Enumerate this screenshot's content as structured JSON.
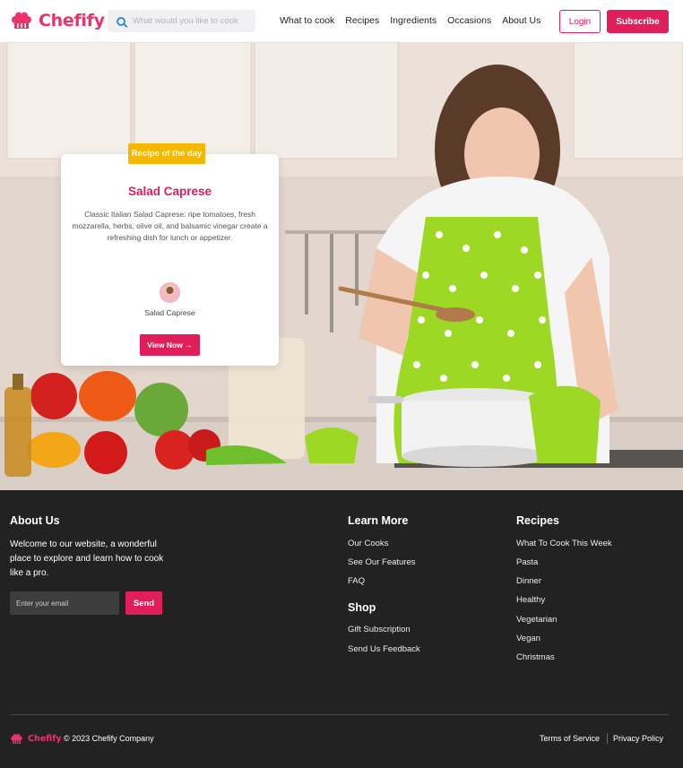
{
  "brand": {
    "name": "Chefify",
    "accent": "#e01e5a",
    "badge_color": "#f5b700",
    "footer_bg": "#222222"
  },
  "header": {
    "search_placeholder": "What would you like to cook",
    "nav": [
      "What to cook",
      "Recipes",
      "Ingredients",
      "Occasions",
      "About Us"
    ],
    "login_label": "Login",
    "subscribe_label": "Subscribe"
  },
  "hero": {
    "badge": "Recipe of the day",
    "title": "Salad Caprese",
    "description": "Classic Italian Salad Caprese: ripe tomatoes, fresh mozzarella, herbs, olive oil, and balsamic vinegar create a refreshing dish for lunch or appetizer.",
    "author_name": "Salad Caprese",
    "cta": "View Now →"
  },
  "footer": {
    "about": {
      "heading": "About Us",
      "text": "Welcome to our website, a wonderful place to explore and learn how to cook like a pro.",
      "email_placeholder": "Enter your email",
      "send_label": "Send"
    },
    "learn_more": {
      "heading": "Learn More",
      "links": [
        "Our Cooks",
        "See Our Features",
        "FAQ"
      ]
    },
    "shop": {
      "heading": "Shop",
      "links": [
        "Gift Subscription",
        "Send Us Feedback"
      ]
    },
    "recipes": {
      "heading": "Recipes",
      "links": [
        "What To Cook This Week",
        "Pasta",
        "Dinner",
        "Healthy",
        "Vegetarian",
        "Vegan",
        "Christmas"
      ]
    },
    "copyright": "© 2023 Chefify Company",
    "terms": "Terms of Service",
    "privacy": "Privacy Policy"
  }
}
